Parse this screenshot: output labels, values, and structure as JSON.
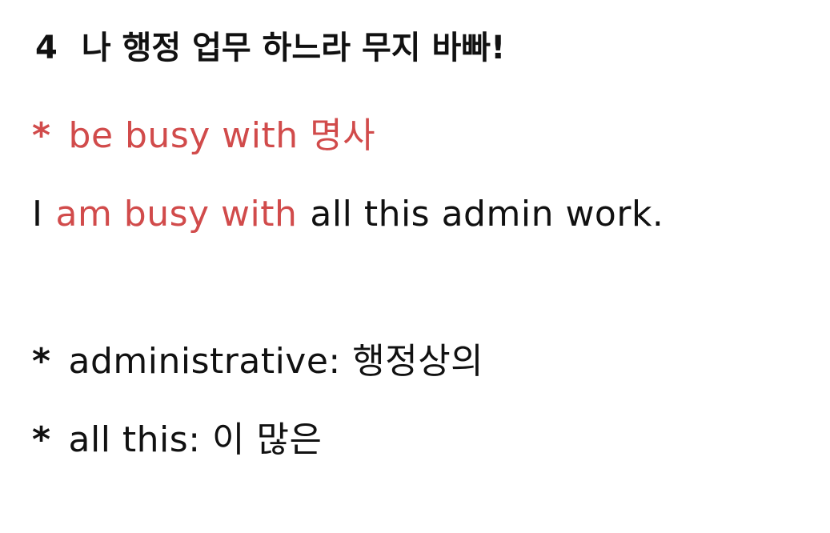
{
  "heading": {
    "number": "4",
    "text": "나 행정 업무 하느라 무지 바빠!"
  },
  "pattern": {
    "bullet": "*",
    "text": "be busy with 명사"
  },
  "example": {
    "subject": "I",
    "highlight": "am busy with",
    "rest": "all this admin work."
  },
  "vocab": [
    {
      "bullet": "*",
      "text": "administrative: 행정상의"
    },
    {
      "bullet": "*",
      "text": "all this: 이 많은"
    }
  ],
  "colors": {
    "accent_red": "#d14b4b",
    "text_black": "#111111"
  }
}
